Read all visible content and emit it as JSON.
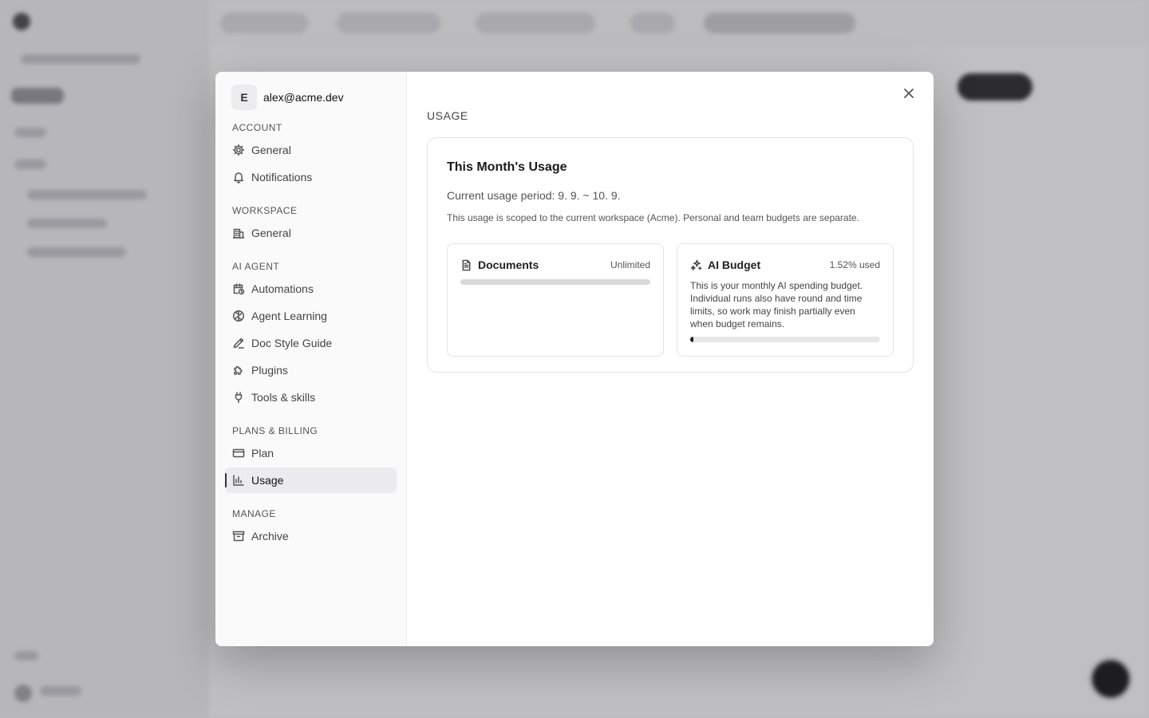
{
  "account": {
    "avatar_initial": "E",
    "email": "alex@acme.dev"
  },
  "nav": {
    "sections": {
      "account": {
        "title": "ACCOUNT",
        "items": {
          "general": "General",
          "notifications": "Notifications"
        }
      },
      "workspace": {
        "title": "WORKSPACE",
        "items": {
          "general": "General"
        }
      },
      "ai_agent": {
        "title": "AI AGENT",
        "items": {
          "automations": "Automations",
          "agent_learning": "Agent Learning",
          "doc_style_guide": "Doc Style Guide",
          "plugins": "Plugins",
          "tools_skills": "Tools & skills"
        }
      },
      "plans_billing": {
        "title": "PLANS & BILLING",
        "items": {
          "plan": "Plan",
          "usage": "Usage"
        }
      },
      "manage": {
        "title": "MANAGE",
        "items": {
          "archive": "Archive"
        }
      }
    },
    "active_item": "usage"
  },
  "content": {
    "page_title": "USAGE",
    "card": {
      "title": "This Month's Usage",
      "period": "Current usage period: 9. 9. ~ 10. 9.",
      "scope_note": "This usage is scoped to the current workspace (Acme). Personal and team budgets are separate.",
      "documents": {
        "title": "Documents",
        "meta": "Unlimited",
        "icon": "document-icon"
      },
      "ai_budget": {
        "title": "AI Budget",
        "meta": "1.52% used",
        "used_fraction": 0.0152,
        "icon": "sparkles-icon",
        "description": "This is your monthly AI spending budget. Individual runs also have round and time limits, so work may finish partially even when budget remains."
      }
    }
  },
  "colors": {
    "accent": "#1f1f1f",
    "track": "#e7e7e8"
  }
}
